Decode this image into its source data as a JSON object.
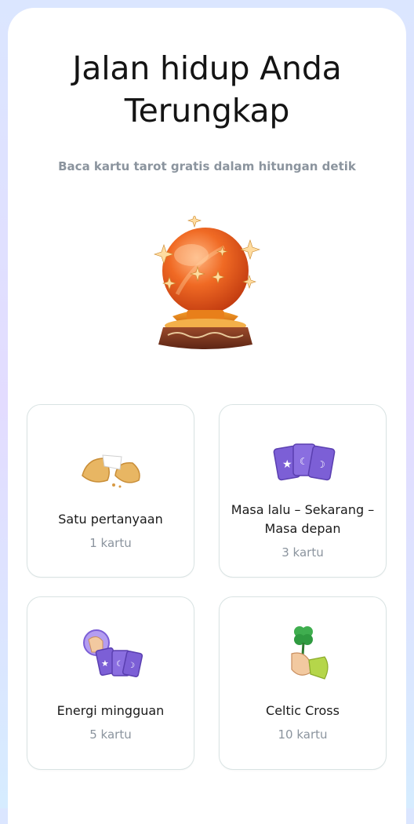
{
  "header": {
    "title_line1": "Jalan hidup Anda",
    "title_line2": "Terungkap",
    "subtitle": "Baca kartu tarot gratis dalam hitungan detik"
  },
  "cards": [
    {
      "name": "Satu pertanyaan",
      "count": "1 kartu",
      "icon": "fortune-cookie-icon"
    },
    {
      "name_line1": "Masa lalu – Sekarang –",
      "name_line2": "Masa depan",
      "count": "3 kartu",
      "icon": "tarot-cards-icon"
    },
    {
      "name": "Energi mingguan",
      "count": "5 kartu",
      "icon": "hand-holding-cards-icon"
    },
    {
      "name": "Celtic Cross",
      "count": "10 kartu",
      "icon": "hand-clover-icon"
    }
  ],
  "colors": {
    "card_purple": "#7c5fd6",
    "crystal_orange": "#e8621c",
    "stand_brown": "#7a3520",
    "card_border": "#d9e3e3",
    "muted_text": "#8b949e"
  }
}
